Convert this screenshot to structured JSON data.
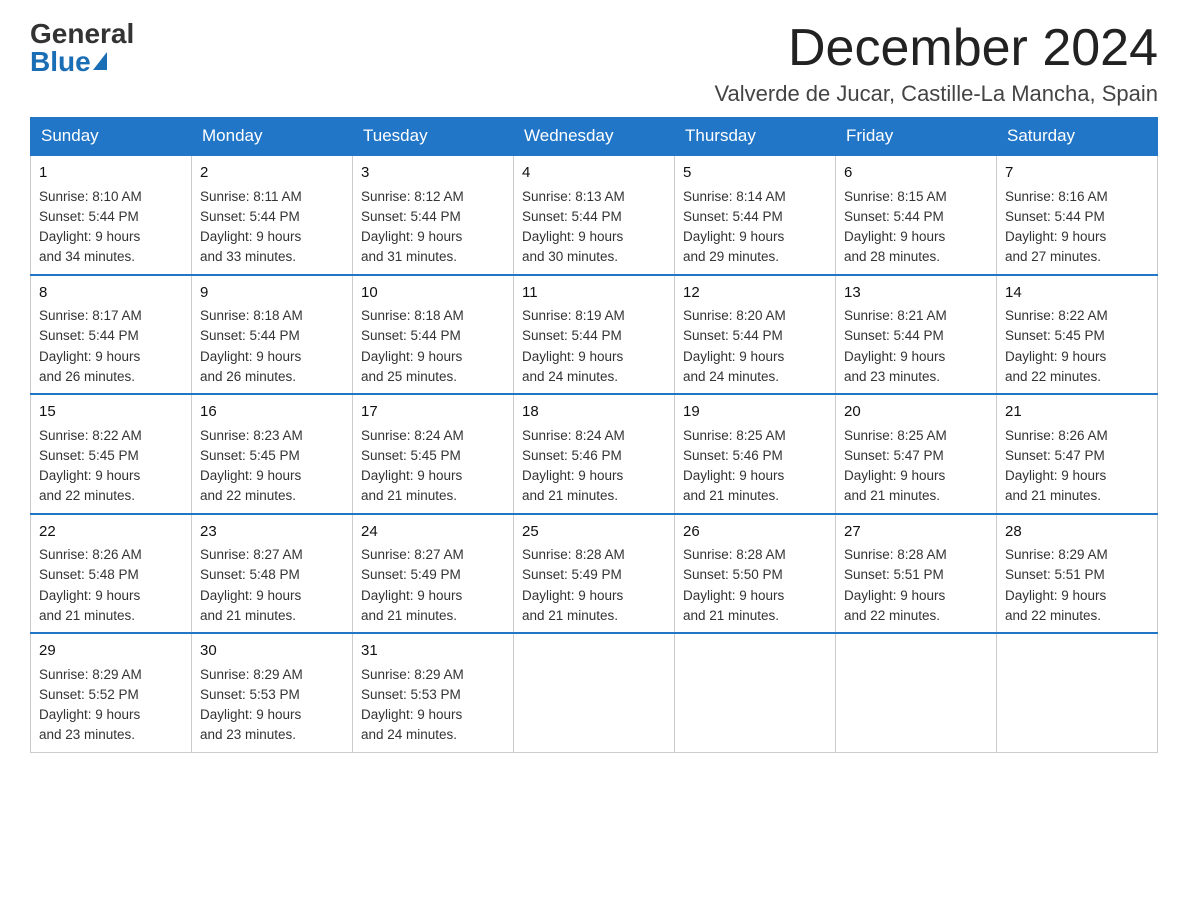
{
  "logo": {
    "general": "General",
    "blue": "Blue"
  },
  "header": {
    "month": "December 2024",
    "location": "Valverde de Jucar, Castille-La Mancha, Spain"
  },
  "days_of_week": [
    "Sunday",
    "Monday",
    "Tuesday",
    "Wednesday",
    "Thursday",
    "Friday",
    "Saturday"
  ],
  "weeks": [
    [
      {
        "day": "1",
        "sunrise": "8:10 AM",
        "sunset": "5:44 PM",
        "daylight": "9 hours and 34 minutes."
      },
      {
        "day": "2",
        "sunrise": "8:11 AM",
        "sunset": "5:44 PM",
        "daylight": "9 hours and 33 minutes."
      },
      {
        "day": "3",
        "sunrise": "8:12 AM",
        "sunset": "5:44 PM",
        "daylight": "9 hours and 31 minutes."
      },
      {
        "day": "4",
        "sunrise": "8:13 AM",
        "sunset": "5:44 PM",
        "daylight": "9 hours and 30 minutes."
      },
      {
        "day": "5",
        "sunrise": "8:14 AM",
        "sunset": "5:44 PM",
        "daylight": "9 hours and 29 minutes."
      },
      {
        "day": "6",
        "sunrise": "8:15 AM",
        "sunset": "5:44 PM",
        "daylight": "9 hours and 28 minutes."
      },
      {
        "day": "7",
        "sunrise": "8:16 AM",
        "sunset": "5:44 PM",
        "daylight": "9 hours and 27 minutes."
      }
    ],
    [
      {
        "day": "8",
        "sunrise": "8:17 AM",
        "sunset": "5:44 PM",
        "daylight": "9 hours and 26 minutes."
      },
      {
        "day": "9",
        "sunrise": "8:18 AM",
        "sunset": "5:44 PM",
        "daylight": "9 hours and 26 minutes."
      },
      {
        "day": "10",
        "sunrise": "8:18 AM",
        "sunset": "5:44 PM",
        "daylight": "9 hours and 25 minutes."
      },
      {
        "day": "11",
        "sunrise": "8:19 AM",
        "sunset": "5:44 PM",
        "daylight": "9 hours and 24 minutes."
      },
      {
        "day": "12",
        "sunrise": "8:20 AM",
        "sunset": "5:44 PM",
        "daylight": "9 hours and 24 minutes."
      },
      {
        "day": "13",
        "sunrise": "8:21 AM",
        "sunset": "5:44 PM",
        "daylight": "9 hours and 23 minutes."
      },
      {
        "day": "14",
        "sunrise": "8:22 AM",
        "sunset": "5:45 PM",
        "daylight": "9 hours and 22 minutes."
      }
    ],
    [
      {
        "day": "15",
        "sunrise": "8:22 AM",
        "sunset": "5:45 PM",
        "daylight": "9 hours and 22 minutes."
      },
      {
        "day": "16",
        "sunrise": "8:23 AM",
        "sunset": "5:45 PM",
        "daylight": "9 hours and 22 minutes."
      },
      {
        "day": "17",
        "sunrise": "8:24 AM",
        "sunset": "5:45 PM",
        "daylight": "9 hours and 21 minutes."
      },
      {
        "day": "18",
        "sunrise": "8:24 AM",
        "sunset": "5:46 PM",
        "daylight": "9 hours and 21 minutes."
      },
      {
        "day": "19",
        "sunrise": "8:25 AM",
        "sunset": "5:46 PM",
        "daylight": "9 hours and 21 minutes."
      },
      {
        "day": "20",
        "sunrise": "8:25 AM",
        "sunset": "5:47 PM",
        "daylight": "9 hours and 21 minutes."
      },
      {
        "day": "21",
        "sunrise": "8:26 AM",
        "sunset": "5:47 PM",
        "daylight": "9 hours and 21 minutes."
      }
    ],
    [
      {
        "day": "22",
        "sunrise": "8:26 AM",
        "sunset": "5:48 PM",
        "daylight": "9 hours and 21 minutes."
      },
      {
        "day": "23",
        "sunrise": "8:27 AM",
        "sunset": "5:48 PM",
        "daylight": "9 hours and 21 minutes."
      },
      {
        "day": "24",
        "sunrise": "8:27 AM",
        "sunset": "5:49 PM",
        "daylight": "9 hours and 21 minutes."
      },
      {
        "day": "25",
        "sunrise": "8:28 AM",
        "sunset": "5:49 PM",
        "daylight": "9 hours and 21 minutes."
      },
      {
        "day": "26",
        "sunrise": "8:28 AM",
        "sunset": "5:50 PM",
        "daylight": "9 hours and 21 minutes."
      },
      {
        "day": "27",
        "sunrise": "8:28 AM",
        "sunset": "5:51 PM",
        "daylight": "9 hours and 22 minutes."
      },
      {
        "day": "28",
        "sunrise": "8:29 AM",
        "sunset": "5:51 PM",
        "daylight": "9 hours and 22 minutes."
      }
    ],
    [
      {
        "day": "29",
        "sunrise": "8:29 AM",
        "sunset": "5:52 PM",
        "daylight": "9 hours and 23 minutes."
      },
      {
        "day": "30",
        "sunrise": "8:29 AM",
        "sunset": "5:53 PM",
        "daylight": "9 hours and 23 minutes."
      },
      {
        "day": "31",
        "sunrise": "8:29 AM",
        "sunset": "5:53 PM",
        "daylight": "9 hours and 24 minutes."
      },
      null,
      null,
      null,
      null
    ]
  ],
  "labels": {
    "sunrise": "Sunrise:",
    "sunset": "Sunset:",
    "daylight": "Daylight:"
  }
}
